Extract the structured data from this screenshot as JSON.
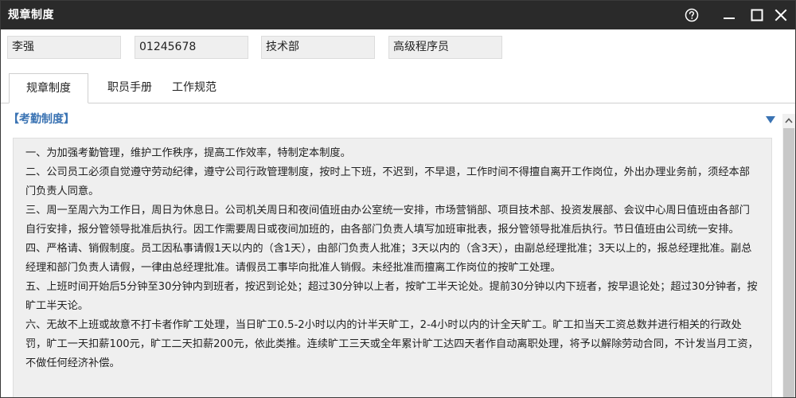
{
  "window": {
    "title": "规章制度",
    "buttons": {
      "help": "help-icon",
      "minimize": "minimize-icon",
      "maximize": "maximize-icon",
      "close": "close-icon"
    }
  },
  "user": {
    "name": "李强",
    "id": "01245678",
    "department": "技术部",
    "position": "高级程序员"
  },
  "tabs": [
    {
      "label": "规章制度",
      "active": true
    },
    {
      "label": "职员手册",
      "active": false
    },
    {
      "label": "工作规范",
      "active": false
    }
  ],
  "section": {
    "title": "【考勤制度】",
    "toggle_icon": "triangle-down-icon"
  },
  "content": {
    "paragraphs": [
      "一、为加强考勤管理，维护工作秩序，提高工作效率，特制定本制度。",
      "二、公司员工必须自觉遵守劳动纪律，遵守公司行政管理制度，按时上下班，不迟到，不早退，工作时间不得擅自离开工作岗位，外出办理业务前，须经本部门负责人同意。",
      "三、周一至周六为工作日，周日为休息日。公司机关周日和夜间值班由办公室统一安排，市场营销部、项目技术部、投资发展部、会议中心周日值班由各部门自行安排，报分管领导批准后执行。因工作需要周日或夜间加班的，由各部门负责人填写加班审批表，报分管领导批准后执行。节日值班由公司统一安排。",
      "四、严格请、销假制度。员工因私事请假1天以内的（含1天），由部门负责人批准；3天以内的（含3天），由副总经理批准；3天以上的，报总经理批准。副总经理和部门负责人请假，一律由总经理批准。请假员工事毕向批准人销假。未经批准而擅离工作岗位的按旷工处理。",
      "五、上班时间开始后5分钟至30分钟内到班者，按迟到论处；超过30分钟以上者，按旷工半天论处。提前30分钟以内下班者，按早退论处；超过30分钟者，按旷工半天论。",
      "六、无故不上班或故意不打卡者作旷工处理，当日旷工0.5-2小时以内的计半天旷工，2-4小时以内的计全天旷工。旷工扣当天工资总数并进行相关的行政处罚，旷工一天扣薪100元，旷工二天扣薪200元，依此类推。连续旷工三天或全年累计旷工达四天者作自动离职处理，将予以解除劳动合同，不计发当月工资，不做任何经济补偿。"
    ]
  },
  "colors": {
    "titlebar": "#2a2a2a",
    "section_title": "#3a73b3",
    "content_bg": "#efefef"
  }
}
